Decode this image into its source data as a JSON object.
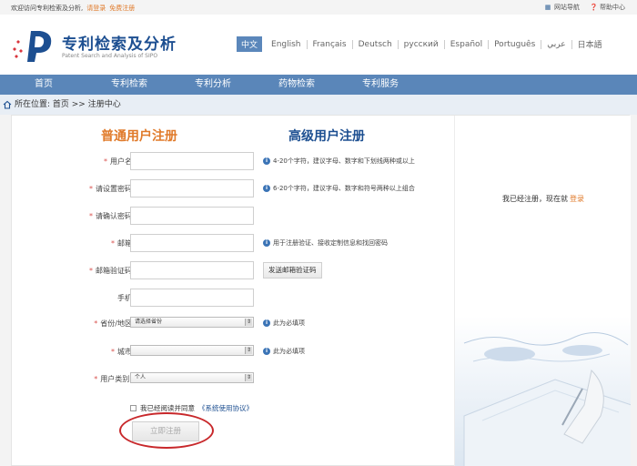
{
  "topbar": {
    "welcome": "欢迎访问专利检索及分析,",
    "login": "请登录",
    "register": "免费注册",
    "sitemap": "网站导航",
    "help": "帮助中心"
  },
  "header": {
    "title": "专利检索及分析",
    "subtitle": "Patent Search and Analysis of SIPO",
    "languages": [
      "中文",
      "English",
      "Français",
      "Deutsch",
      "русский",
      "Español",
      "Português",
      "عربي",
      "日本語"
    ]
  },
  "nav": [
    "首页",
    "专利检索",
    "专利分析",
    "药物检索",
    "专利服务"
  ],
  "breadcrumb": "所在位置: 首页 >> 注册中心",
  "tabs": {
    "normal": "普通用户注册",
    "advanced": "高级用户注册"
  },
  "form": {
    "username_label": "用户名",
    "username_hint": "4-20个字符，建议字母、数字和下划线两种或以上",
    "password_label": "请设置密码",
    "password_hint": "6-20个字符，建议字母、数字和符号两种以上组合",
    "confirm_label": "请确认密码",
    "email_label": "邮箱",
    "email_hint": "用于注册验证、接收定制信息和找回密码",
    "code_label": "邮箱验证码",
    "send_code": "发送邮箱验证码",
    "phone_label": "手机",
    "province_label": "省份/地区",
    "province_value": "请选择省份",
    "province_hint": "此为必填项",
    "city_label": "城市",
    "city_value": "",
    "city_hint": "此为必填项",
    "usertype_label": "用户类别:",
    "usertype_value": "个人",
    "agree_text": "我已经阅读并同意",
    "agree_link": "《系统使用协议》",
    "submit": "立即注册"
  },
  "side": {
    "already": "我已经注册，现在就",
    "login": "登录"
  },
  "colors": {
    "nav": "#5a86b9",
    "brand": "#1d4f91",
    "accent": "#e07a2a",
    "highlight_circle": "#c8282b"
  }
}
